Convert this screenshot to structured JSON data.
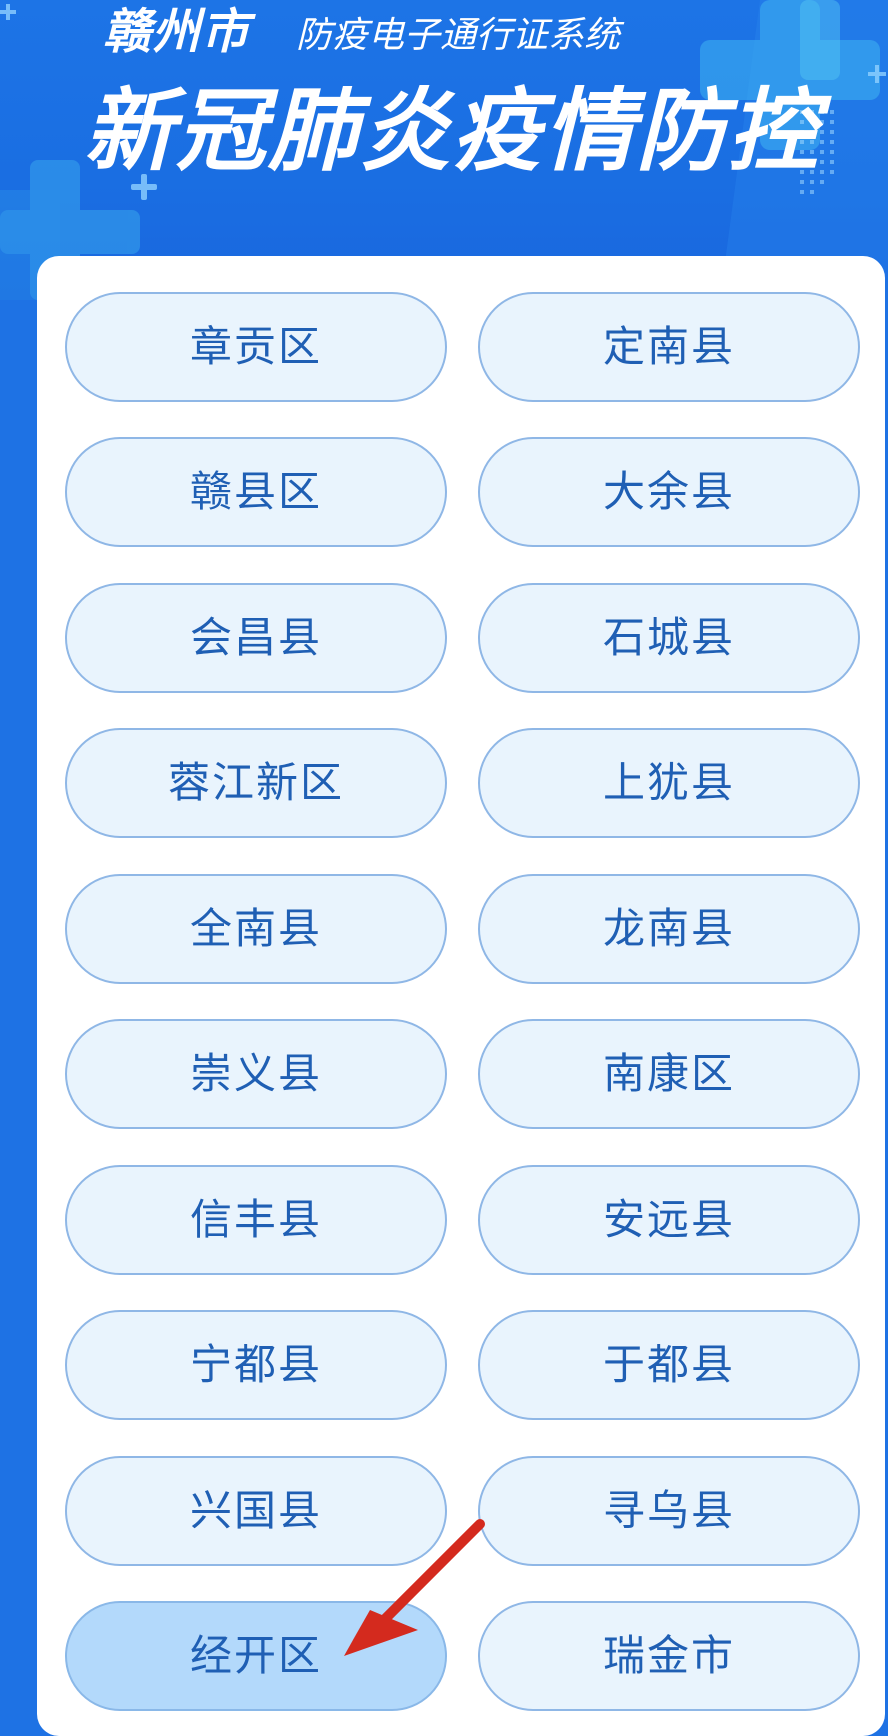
{
  "header": {
    "city": "赣州市",
    "system_name": "防疫电子通行证系统",
    "main_title": "新冠肺炎疫情防控"
  },
  "regions": [
    {
      "label": "章贡区",
      "selected": false
    },
    {
      "label": "定南县",
      "selected": false
    },
    {
      "label": "赣县区",
      "selected": false
    },
    {
      "label": "大余县",
      "selected": false
    },
    {
      "label": "会昌县",
      "selected": false
    },
    {
      "label": "石城县",
      "selected": false
    },
    {
      "label": "蓉江新区",
      "selected": false
    },
    {
      "label": "上犹县",
      "selected": false
    },
    {
      "label": "全南县",
      "selected": false
    },
    {
      "label": "龙南县",
      "selected": false
    },
    {
      "label": "崇义县",
      "selected": false
    },
    {
      "label": "南康区",
      "selected": false
    },
    {
      "label": "信丰县",
      "selected": false
    },
    {
      "label": "安远县",
      "selected": false
    },
    {
      "label": "宁都县",
      "selected": false
    },
    {
      "label": "于都县",
      "selected": false
    },
    {
      "label": "兴国县",
      "selected": false
    },
    {
      "label": "寻乌县",
      "selected": false
    },
    {
      "label": "经开区",
      "selected": true
    },
    {
      "label": "瑞金市",
      "selected": false
    }
  ],
  "colors": {
    "header_blue": "#1e72e4",
    "button_fill": "#e9f4fd",
    "button_selected_fill": "#b3d9fb",
    "button_border": "#8fb7e6",
    "button_text": "#1f5fb4",
    "arrow_red": "#d42a1e"
  },
  "annotation": {
    "icon": "red-arrow-icon",
    "target": "经开区"
  }
}
